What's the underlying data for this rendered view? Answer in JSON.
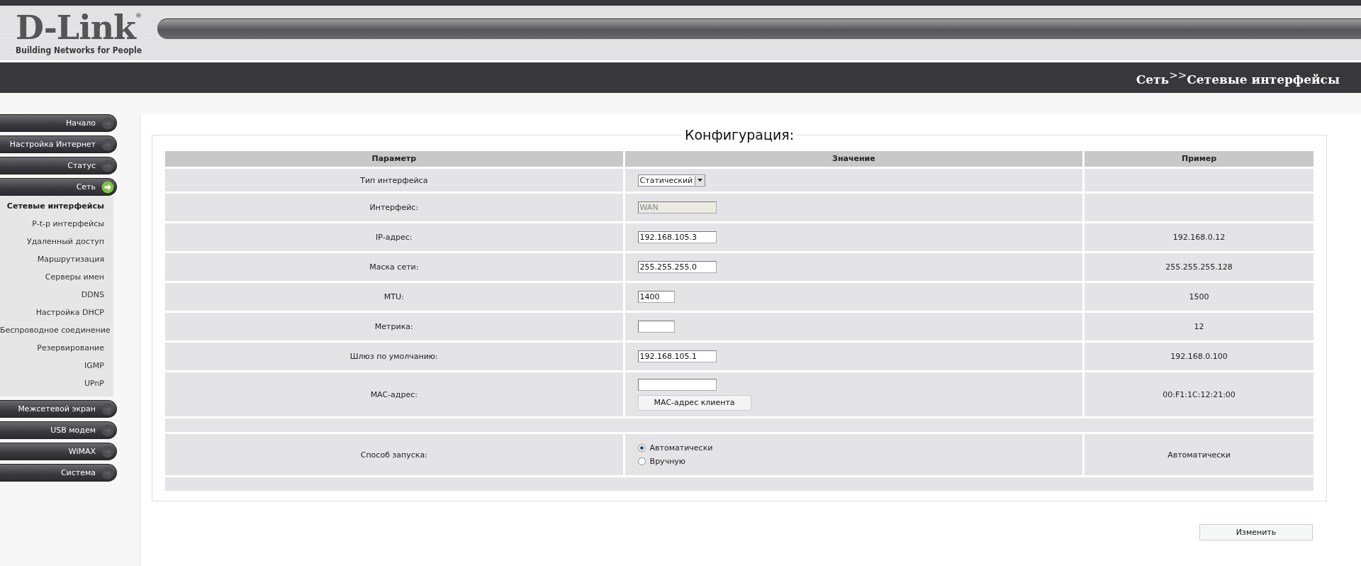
{
  "header": {
    "logo": "D-Link",
    "logo_mark": "®",
    "tagline": "Building Networks for People",
    "breadcrumb": "Сеть$^{>>}$Сетевые интерфейсы"
  },
  "sidebar": {
    "items": [
      {
        "label": "Начало",
        "expanded": false
      },
      {
        "label": "Настройка Интернет",
        "expanded": false
      },
      {
        "label": "Статус",
        "expanded": false
      },
      {
        "label": "Сеть",
        "expanded": true,
        "children": [
          {
            "label": "Сетевые интерфейсы",
            "selected": true
          },
          {
            "label": "P-t-p интерфейсы",
            "selected": false
          },
          {
            "label": "Удаленный доступ",
            "selected": false
          },
          {
            "label": "Маршрутизация",
            "selected": false
          },
          {
            "label": "Серверы имен",
            "selected": false
          },
          {
            "label": "DDNS",
            "selected": false
          },
          {
            "label": "Настройка DHCP",
            "selected": false
          },
          {
            "label": "Беспроводное соединение",
            "selected": false
          },
          {
            "label": "Резервирование",
            "selected": false
          },
          {
            "label": "IGMP",
            "selected": false
          },
          {
            "label": "UPnP",
            "selected": false
          }
        ]
      },
      {
        "label": "Межсетевой экран",
        "expanded": false
      },
      {
        "label": "USB модем",
        "expanded": false
      },
      {
        "label": "WiMAX",
        "expanded": false
      },
      {
        "label": "Система",
        "expanded": false
      }
    ]
  },
  "config": {
    "title": "Конфигурация:",
    "columns": [
      "Параметр",
      "Значение",
      "Пример"
    ],
    "rows": [
      {
        "kind": "select",
        "label": "Тип интерфейса",
        "value": "Статический"
      },
      {
        "kind": "input",
        "label": "Интерфейс:",
        "value": "WAN",
        "disabled": true
      },
      {
        "kind": "input",
        "label": "IP-адрес:",
        "value": "192.168.105.3",
        "disabled": false,
        "example": "192.168.0.12"
      },
      {
        "kind": "input",
        "label": "Маска сети:",
        "value": "255.255.255.0",
        "disabled": false,
        "example": "255.255.255.128"
      },
      {
        "kind": "shortinput",
        "label": "MTU:",
        "value": "1400",
        "disabled": false,
        "example": "1500"
      },
      {
        "kind": "shortinput",
        "label": "Метрика:",
        "disabled": false,
        "example": "12"
      },
      {
        "kind": "input",
        "label": "Шлюз по умолчанию:",
        "value": "192.168.105.1",
        "disabled": false,
        "example": "192.168.0.100"
      },
      {
        "kind": "mac",
        "label": "MAC-адрес:",
        "button": "MAC-адрес клиента",
        "example": "00:F1:1C:12:21:00"
      },
      {
        "kind": "spacer"
      },
      {
        "kind": "radio",
        "label": "Способ запуска:",
        "options": [
          {
            "label": "Автоматически",
            "selected": true
          },
          {
            "label": "Вручную",
            "selected": false
          }
        ],
        "example": "Автоматически"
      },
      {
        "kind": "spacer"
      }
    ],
    "submit": "Изменить"
  }
}
